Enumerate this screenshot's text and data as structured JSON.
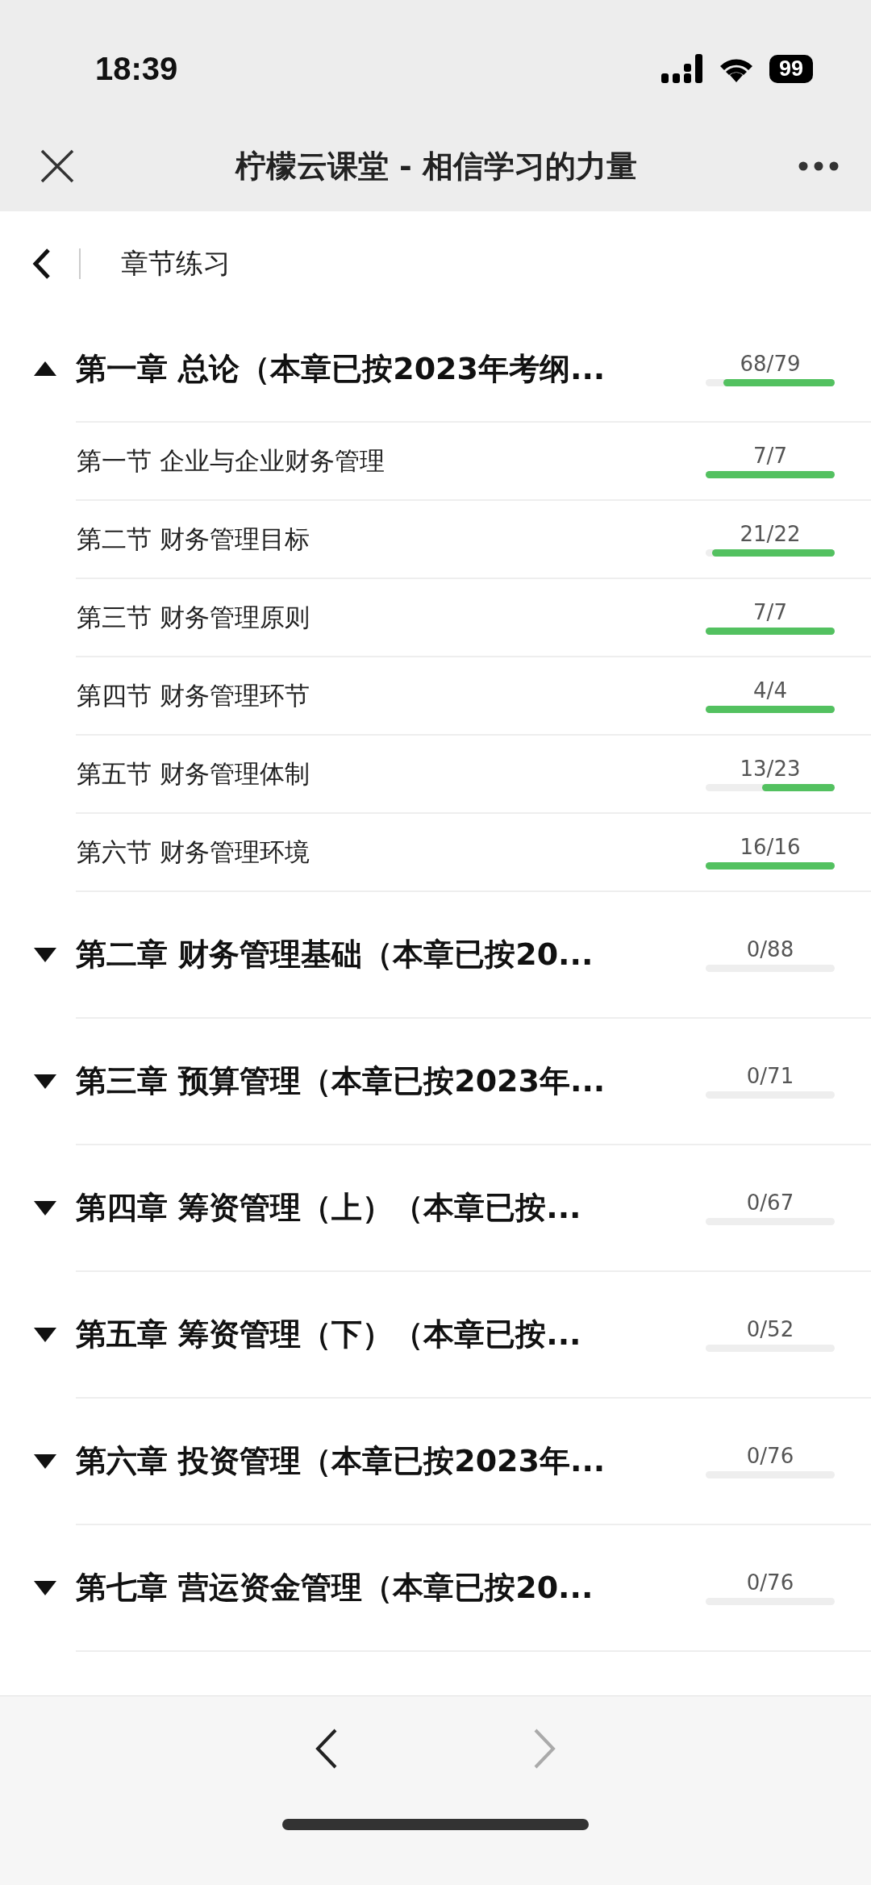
{
  "status_bar": {
    "time": "18:39",
    "battery": "99"
  },
  "nav_bar": {
    "title": "柠檬云课堂 - 相信学习的力量"
  },
  "page_header": {
    "title": "章节练习"
  },
  "chapters": [
    {
      "title": "第一章 总论（本章已按2023年考纲...",
      "count": "68/79",
      "level": 0.86,
      "expanded": true,
      "sections": [
        {
          "title": "第一节 企业与企业财务管理",
          "count": "7/7",
          "level": 1
        },
        {
          "title": "第二节 财务管理目标",
          "count": "21/22",
          "level": 0.95
        },
        {
          "title": "第三节 财务管理原则",
          "count": "7/7",
          "level": 1
        },
        {
          "title": "第四节 财务管理环节",
          "count": "4/4",
          "level": 1
        },
        {
          "title": "第五节 财务管理体制",
          "count": "13/23",
          "level": 0.565
        },
        {
          "title": "第六节 财务管理环境",
          "count": "16/16",
          "level": 1
        }
      ]
    },
    {
      "title": "第二章 财务管理基础（本章已按20...",
      "count": "0/88",
      "expanded": false
    },
    {
      "title": "第三章 预算管理（本章已按2023年...",
      "count": "0/71",
      "expanded": false
    },
    {
      "title": "第四章 筹资管理（上）（本章已按...",
      "count": "0/67",
      "expanded": false
    },
    {
      "title": "第五章 筹资管理（下）（本章已按...",
      "count": "0/52",
      "expanded": false
    },
    {
      "title": "第六章 投资管理（本章已按2023年...",
      "count": "0/76",
      "expanded": false
    },
    {
      "title": "第七章 营运资金管理（本章已按20...",
      "count": "0/76",
      "expanded": false
    }
  ]
}
